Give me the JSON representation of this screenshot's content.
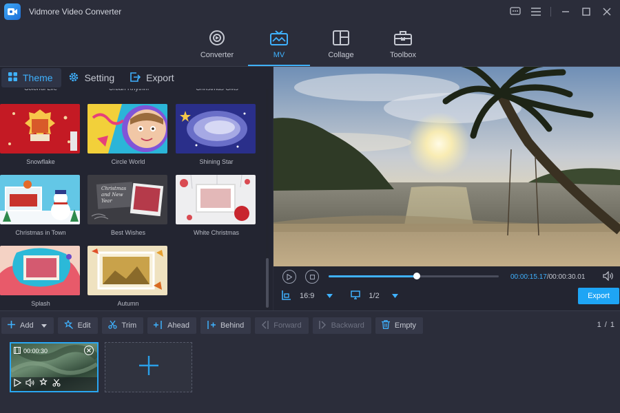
{
  "app": {
    "title": "Vidmore Video Converter"
  },
  "nav": [
    {
      "label": "Converter",
      "icon": "converter-icon"
    },
    {
      "label": "MV",
      "icon": "mv-icon",
      "active": true
    },
    {
      "label": "Collage",
      "icon": "collage-icon"
    },
    {
      "label": "Toolbox",
      "icon": "toolbox-icon"
    }
  ],
  "panel_tabs": [
    {
      "label": "Theme",
      "icon": "grid-icon",
      "active": true
    },
    {
      "label": "Setting",
      "icon": "gear-icon"
    },
    {
      "label": "Export",
      "icon": "export-icon"
    }
  ],
  "themes_top_row": [
    "Colorful Life",
    "Urban Rhythm",
    "Christmas Gifts"
  ],
  "themes": [
    {
      "label": "Snowflake"
    },
    {
      "label": "Circle World"
    },
    {
      "label": "Shining Star"
    },
    {
      "label": "Christmas in Town"
    },
    {
      "label": "Best Wishes",
      "thumb_text": "Christmas and New Year"
    },
    {
      "label": "White Christmas"
    },
    {
      "label": "Splash"
    },
    {
      "label": "Autumn"
    }
  ],
  "player": {
    "current_time": "00:00:15.17",
    "total_time": "/00:00:30.01",
    "progress": 0.52,
    "aspect_ratio": "16:9",
    "page_ratio": "1/2",
    "export_label": "Export"
  },
  "toolbar": {
    "add": "Add",
    "edit": "Edit",
    "trim": "Trim",
    "ahead": "Ahead",
    "behind": "Behind",
    "forward": "Forward",
    "backward": "Backward",
    "empty": "Empty",
    "page_current": "1",
    "page_sep": "/",
    "page_total": "1"
  },
  "clip": {
    "duration": "00:00:30"
  },
  "colors": {
    "accent": "#3fb2ff",
    "background": "#2b2d3a",
    "panel": "#232531",
    "export_button": "#1ea5f5"
  }
}
